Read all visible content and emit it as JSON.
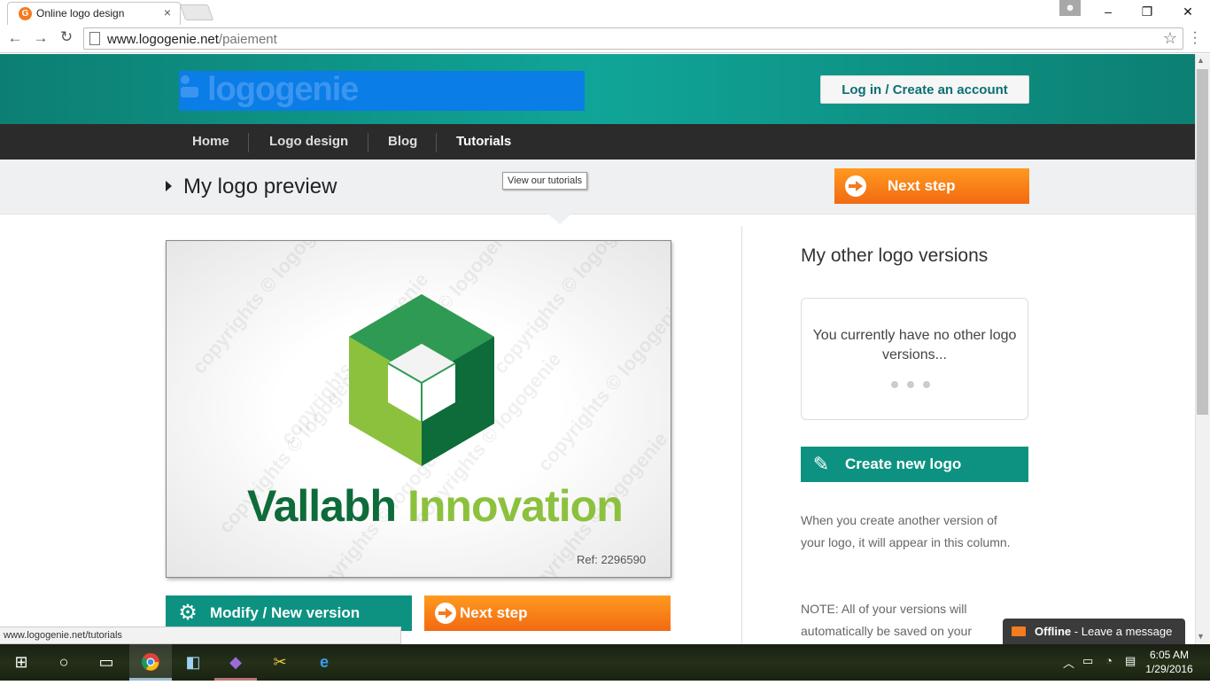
{
  "browser": {
    "tab_title": "Online logo design",
    "tab_close": "×",
    "url_host": "www.logogenie.net",
    "url_path": "/paiement",
    "win_minimize": "–",
    "win_restore": "❐",
    "win_close": "✕",
    "back": "←",
    "forward": "→",
    "reload": "↻",
    "star": "☆",
    "menu": "⋮",
    "status_url": "www.logogenie.net/tutorials"
  },
  "header": {
    "logo_text": "logogenie",
    "login_label": "Log in / Create an account"
  },
  "nav": {
    "items": [
      {
        "label": "Home"
      },
      {
        "label": "Logo design"
      },
      {
        "label": "Blog"
      },
      {
        "label": "Tutorials"
      }
    ]
  },
  "preview": {
    "title": "My logo preview",
    "tooltip": "View our tutorials",
    "next_step_label": "Next step",
    "logo_word1": "Vallabh",
    "logo_word2": "Innovation",
    "ref": "Ref: 2296590",
    "watermark": "copyrights © logogenie",
    "modify_label": "Modify / New version",
    "next_step_bottom": "Next step"
  },
  "sidebar": {
    "title": "My other logo versions",
    "no_versions": "You currently have no other logo versions...",
    "create_label": "Create new logo",
    "description": "When you create another version of your logo, it will appear in this column.",
    "note": "NOTE: All of your versions will automatically be saved on your"
  },
  "chat": {
    "status": "Offline",
    "label": "- Leave a message"
  },
  "taskbar": {
    "time": "6:05 AM",
    "date": "1/29/2016"
  },
  "colors": {
    "teal": "#0d9281",
    "orange": "#f47b20",
    "dark_green": "#0e6b3a",
    "light_green": "#8cc13e"
  }
}
